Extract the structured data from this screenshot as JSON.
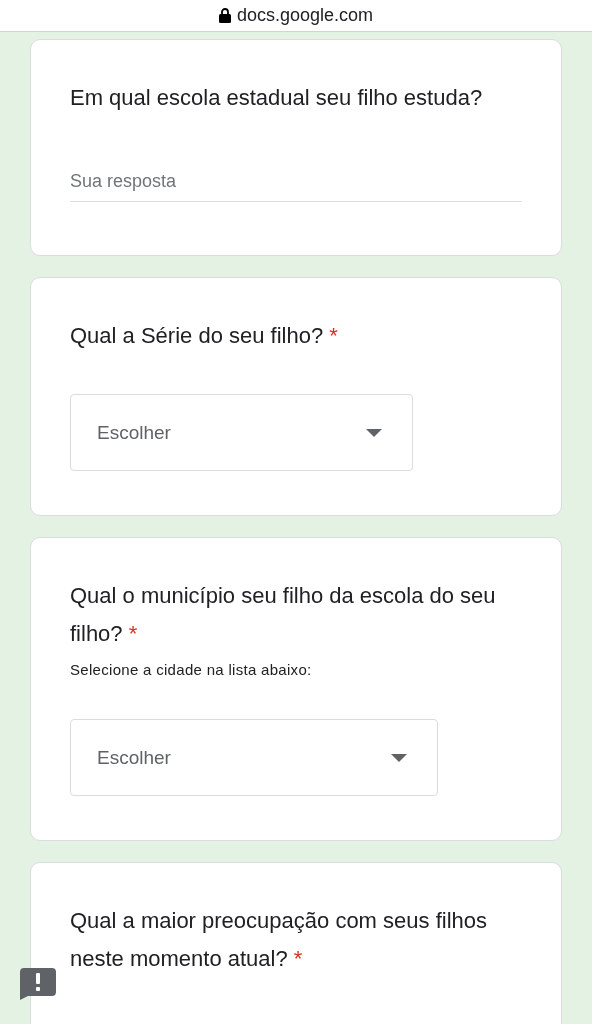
{
  "address_bar": {
    "url": "docs.google.com"
  },
  "questions": [
    {
      "kind": "text",
      "title": "Em qual escola estadual seu filho estuda?",
      "placeholder": "Sua resposta"
    },
    {
      "kind": "dropdown",
      "title": "Qual a Série do seu filho?",
      "required_mark": "*",
      "placeholder": "Escolher"
    },
    {
      "kind": "dropdown",
      "title": "Qual o município seu filho da escola do seu filho?",
      "required_mark": "*",
      "description": "Selecione a cidade na lista abaixo:",
      "placeholder": "Escolher"
    },
    {
      "kind": "partial",
      "title": "Qual a maior preocupação com seus filhos neste momento atual?",
      "required_mark": "*"
    }
  ]
}
